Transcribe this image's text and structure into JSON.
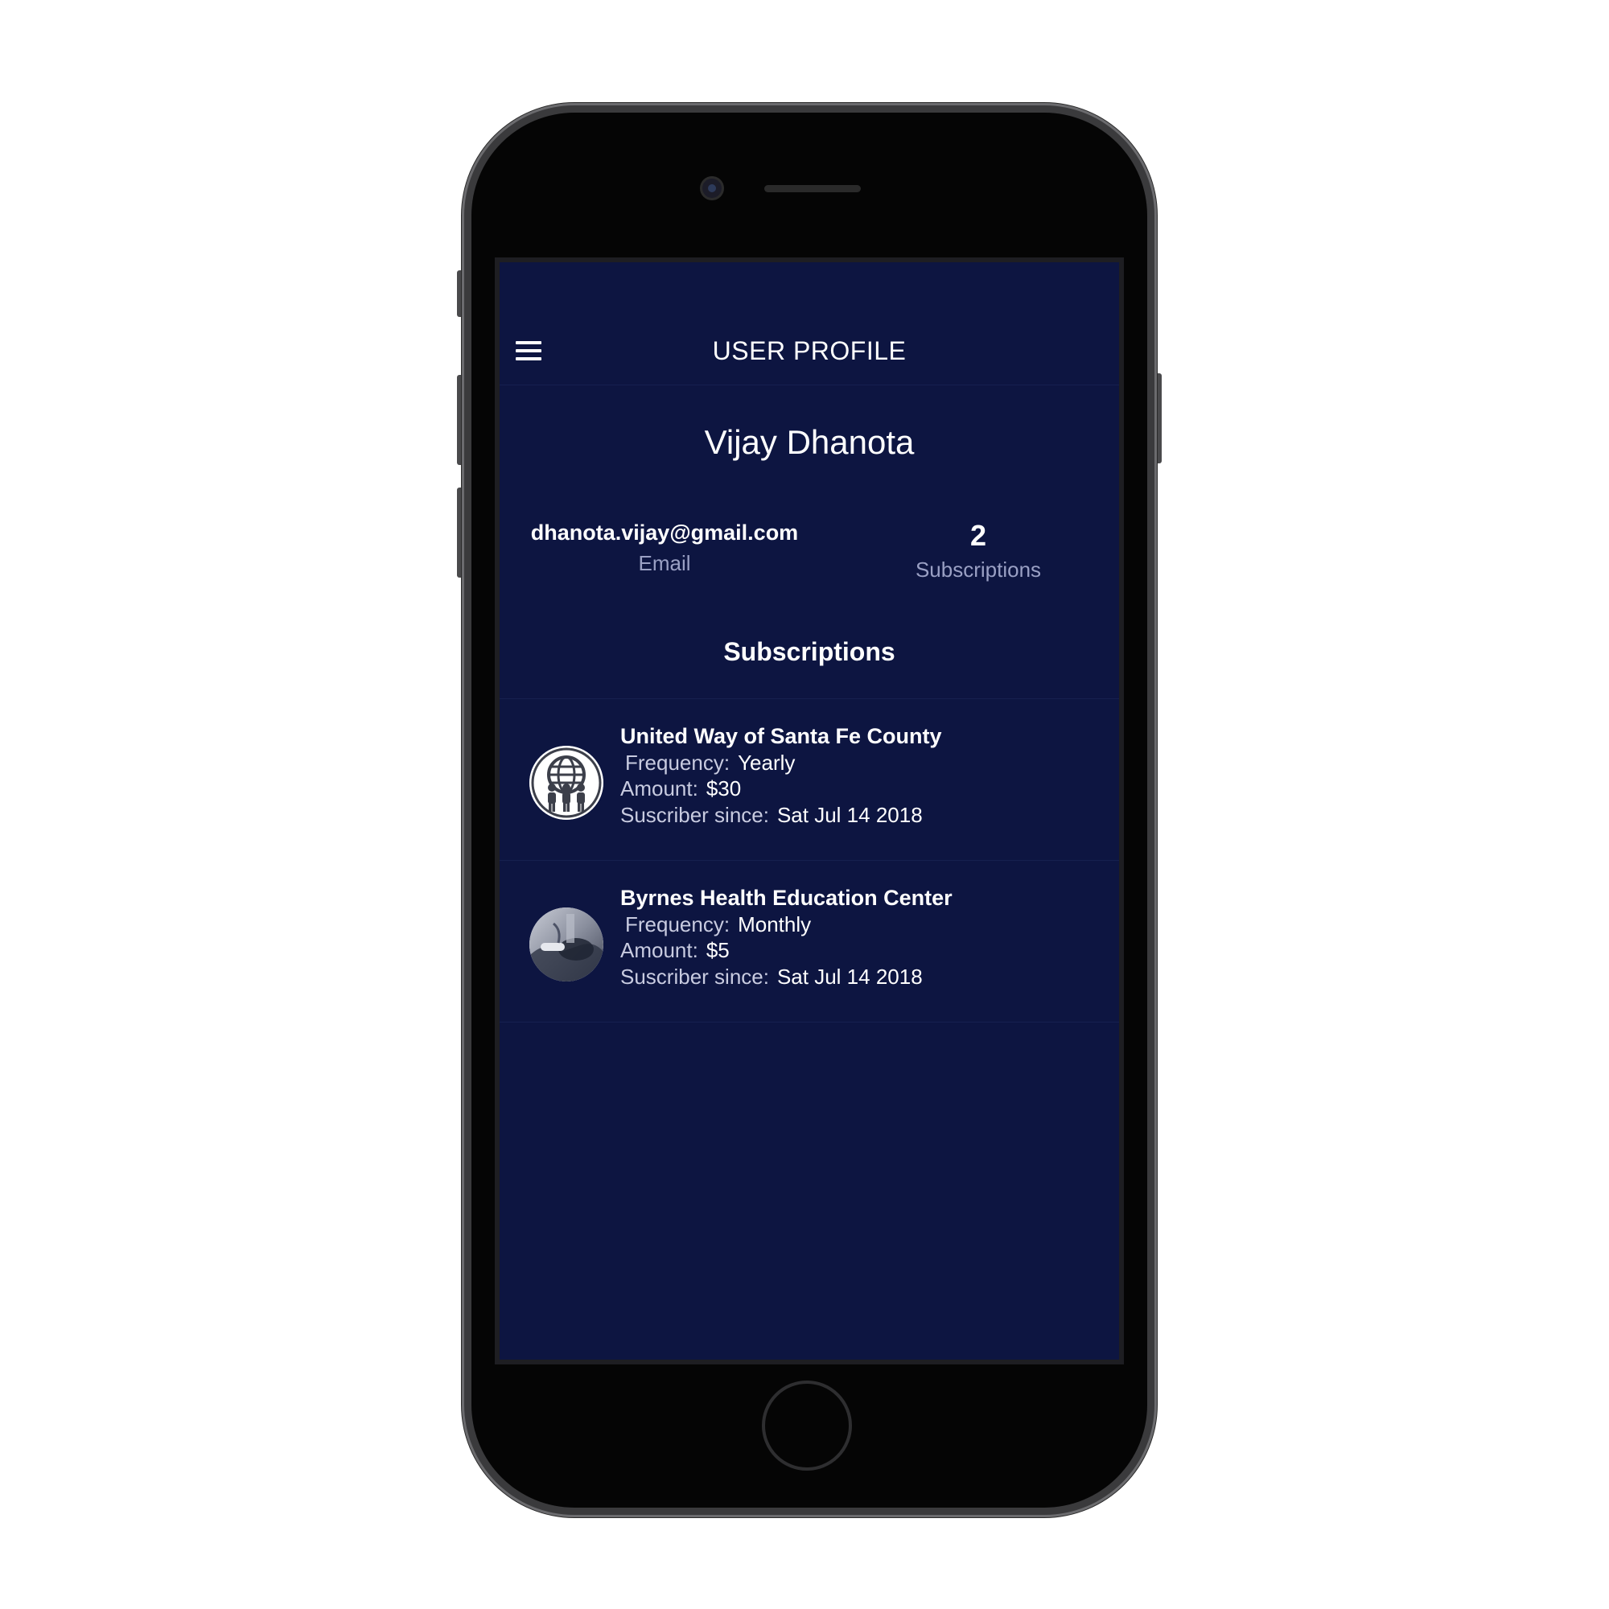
{
  "header": {
    "title": "USER PROFILE",
    "menu_icon": "hamburger-menu-icon"
  },
  "profile": {
    "name": "Vijay Dhanota",
    "email": "dhanota.vijay@gmail.com",
    "email_label": "Email",
    "subscription_count": "2",
    "subscription_count_label": "Subscriptions"
  },
  "subscriptions_section": {
    "title": "Subscriptions",
    "frequency_label": "Frequency:",
    "amount_label": "Amount:",
    "since_label": "Suscriber since:",
    "items": [
      {
        "name": "United Way of Santa Fe County",
        "frequency": "Yearly",
        "amount": "$30",
        "since": "Sat Jul 14 2018",
        "icon": "globe-people-icon"
      },
      {
        "name": "Byrnes Health Education Center",
        "frequency": "Monthly",
        "amount": "$5",
        "since": "Sat Jul 14 2018",
        "icon": "health-checkup-photo"
      }
    ]
  },
  "colors": {
    "screen_background": "#0d1541",
    "text_primary": "#ffffff",
    "text_muted": "#9aa0c4",
    "device_frame": "#3a3a3c"
  }
}
